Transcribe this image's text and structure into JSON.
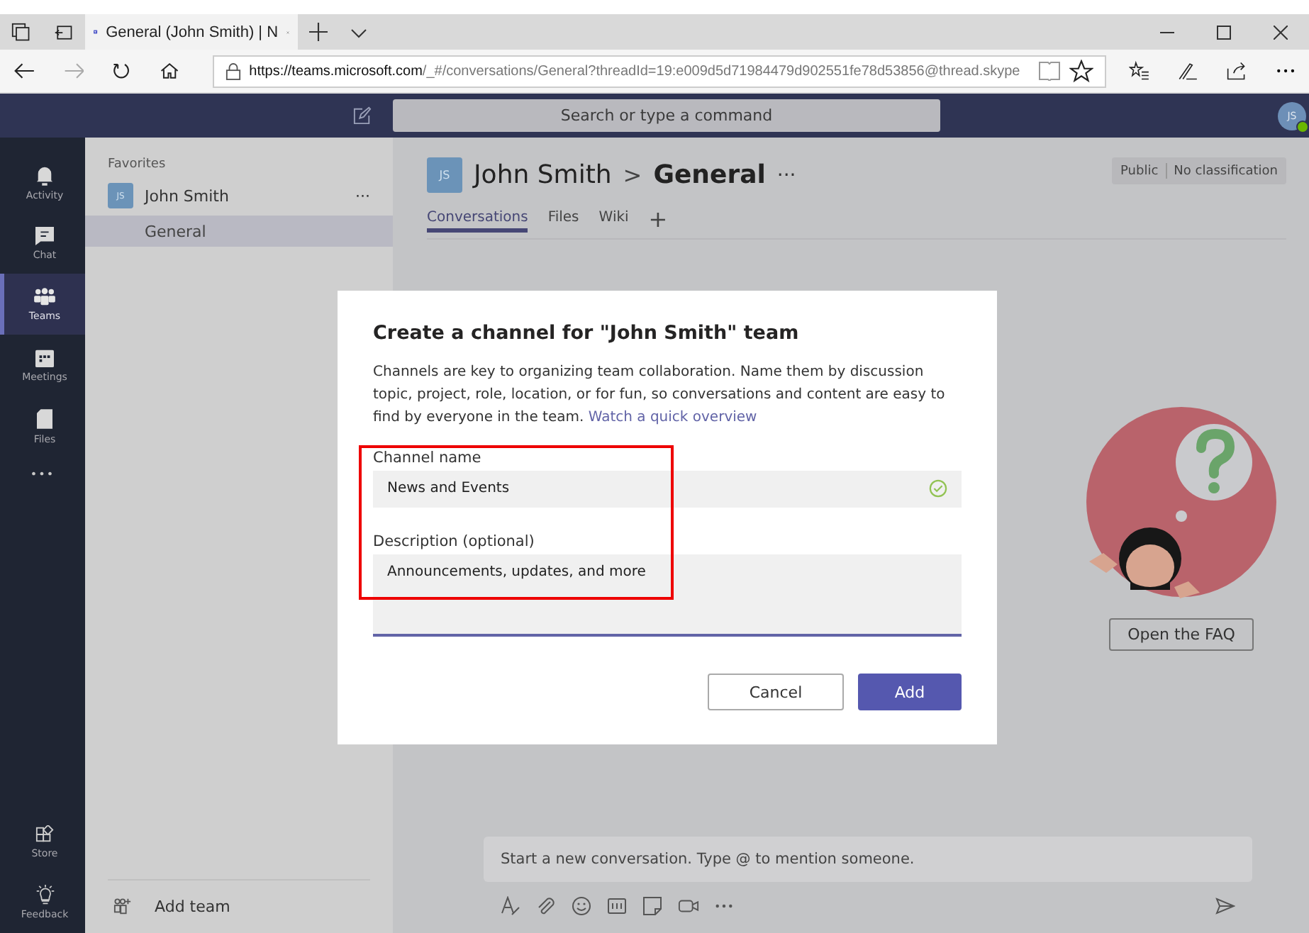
{
  "browser": {
    "tabs": [
      {
        "title": "General (John Smith) | N",
        "selected": true
      }
    ],
    "address": {
      "host": "https://teams.microsoft.com",
      "path": "/_#/conversations/General?threadId=19:e009d5d71984479d902551fe78d53856@thread.skype"
    }
  },
  "header": {
    "search_placeholder": "Search or type a command",
    "avatar": "JS"
  },
  "rail": {
    "items": [
      {
        "label": "Activity",
        "selected": false
      },
      {
        "label": "Chat",
        "selected": false
      },
      {
        "label": "Teams",
        "selected": true
      },
      {
        "label": "Meetings",
        "selected": false
      },
      {
        "label": "Files",
        "selected": false
      }
    ],
    "more": "•••",
    "bottom": [
      {
        "label": "Store"
      },
      {
        "label": "Feedback"
      }
    ]
  },
  "sidebar": {
    "section": "Favorites",
    "team": {
      "initials": "JS",
      "name": "John Smith",
      "more": "···"
    },
    "channels": [
      {
        "name": "General",
        "selected": true
      }
    ],
    "add_team": "Add team"
  },
  "channel_header": {
    "initials": "JS",
    "team": "John Smith",
    "separator": ">",
    "channel": "General",
    "more": "···",
    "tabs": [
      {
        "label": "Conversations",
        "selected": true
      },
      {
        "label": "Files",
        "selected": false
      },
      {
        "label": "Wiki",
        "selected": false
      }
    ],
    "add_tab": "+",
    "badges": [
      "Public",
      "No classification"
    ]
  },
  "welcome": {
    "faq_button": "Open the FAQ"
  },
  "compose": {
    "placeholder": "Start a new conversation. Type @ to mention someone."
  },
  "dialog": {
    "title": "Create a channel for \"John Smith\" team",
    "description": "Channels are key to organizing team collaboration. Name them by discussion topic, project, role, location, or for fun, so conversations and content are easy to find by everyone in the team.",
    "link": "Watch a quick overview",
    "fields": [
      {
        "label": "Channel name",
        "value": "News and Events",
        "valid": true,
        "focused": false,
        "multiline": false
      },
      {
        "label": "Description (optional)",
        "value": "Announcements, updates, and more",
        "valid": false,
        "focused": true,
        "multiline": true
      }
    ],
    "buttons": [
      {
        "label": "Cancel",
        "primary": false
      },
      {
        "label": "Add",
        "primary": true
      }
    ],
    "highlighted": true
  }
}
